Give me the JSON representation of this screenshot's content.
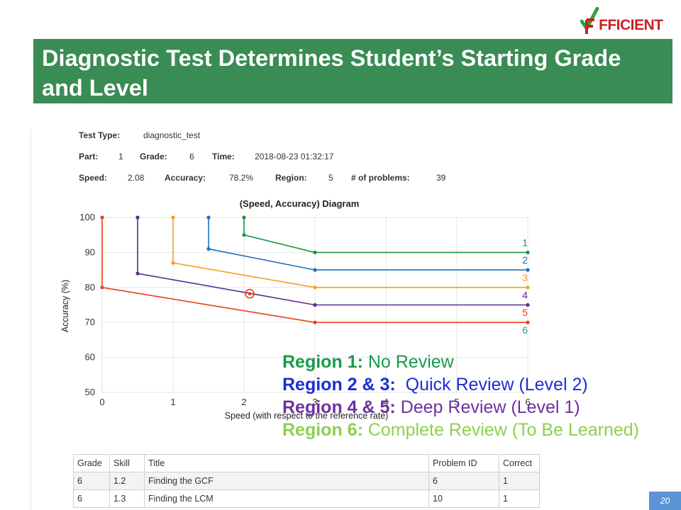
{
  "logo": {
    "text": "FFICIENT"
  },
  "slide": {
    "title": "Diagnostic Test Determines Student’s Starting Grade and Level",
    "page_number": "20"
  },
  "meta": {
    "test_type_label": "Test Type:",
    "test_type": "diagnostic_test",
    "part_label": "Part:",
    "part": "1",
    "grade_label": "Grade:",
    "grade": "6",
    "time_label": "Time:",
    "time": "2018-08-23 01:32:17",
    "speed_label": "Speed:",
    "speed": "2.08",
    "accuracy_label": "Accuracy:",
    "accuracy": "78.2%",
    "region_label": "Region:",
    "region": "5",
    "problems_label": "# of problems:",
    "problems": "39"
  },
  "chart_data": {
    "type": "line",
    "title": "(Speed, Accuracy) Diagram",
    "xlabel": "Speed (with respect to the reference rate)",
    "ylabel": "Accuracy (%)",
    "xlim": [
      0,
      6
    ],
    "ylim": [
      50,
      100
    ],
    "xticks": [
      "0",
      "1",
      "2",
      "3",
      "4",
      "5",
      "6"
    ],
    "yticks": [
      "50",
      "60",
      "70",
      "80",
      "90",
      "100"
    ],
    "series": [
      {
        "name": "1",
        "color": "#1a9641",
        "points": [
          [
            2,
            100
          ],
          [
            2,
            95
          ],
          [
            3,
            90
          ],
          [
            6,
            90
          ]
        ]
      },
      {
        "name": "2",
        "color": "#1f6fbf",
        "points": [
          [
            1.5,
            100
          ],
          [
            1.5,
            91
          ],
          [
            3,
            85
          ],
          [
            6,
            85
          ]
        ]
      },
      {
        "name": "3",
        "color": "#f5a01a",
        "points": [
          [
            1.0,
            100
          ],
          [
            1.0,
            87
          ],
          [
            3,
            80
          ],
          [
            6,
            80
          ]
        ]
      },
      {
        "name": "4",
        "color": "#5b2a91",
        "points": [
          [
            0.5,
            100
          ],
          [
            0.5,
            84
          ],
          [
            3,
            75
          ],
          [
            6,
            75
          ]
        ]
      },
      {
        "name": "5",
        "color": "#e8401c",
        "points": [
          [
            0,
            100
          ],
          [
            0,
            80
          ],
          [
            3,
            70
          ],
          [
            6,
            70
          ]
        ]
      },
      {
        "name": "6",
        "color": "#1aa39a",
        "points": []
      }
    ],
    "marker": {
      "x": 2.08,
      "y": 78.2,
      "color": "#e8401c"
    }
  },
  "regions": [
    {
      "label": "Region 1:",
      "text": " No Review",
      "color": "#1a9a4a"
    },
    {
      "label": "Region 2 & 3:",
      "text": "  Quick Review (Level 2)",
      "color": "#1c2fd1"
    },
    {
      "label": "Region 4 & 5:",
      "text": " Deep Review (Level 1)",
      "color": "#7030a0"
    },
    {
      "label": "Region 6:",
      "text": " Complete Review (To Be Learned)",
      "color": "#8fcf4f"
    }
  ],
  "table": {
    "headers": [
      "Grade",
      "Skill",
      "Title",
      "Problem ID",
      "Correct"
    ],
    "rows": [
      [
        "6",
        "1.2",
        "Finding the GCF",
        "6",
        "1"
      ],
      [
        "6",
        "1.3",
        "Finding the LCM",
        "10",
        "1"
      ]
    ]
  }
}
